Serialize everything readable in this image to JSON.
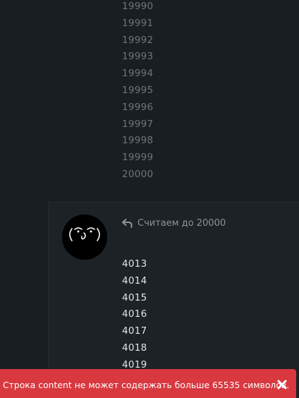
{
  "quoted_post": {
    "lines": [
      "19990",
      "19991",
      "19992",
      "19993",
      "19994",
      "19995",
      "19996",
      "19997",
      "19998",
      "19999",
      "20000"
    ]
  },
  "post": {
    "avatar_icon": "lenny-face-avatar",
    "reply_label": "Считаем до 20000",
    "lines": [
      "4013",
      "4014",
      "4015",
      "4016",
      "4017",
      "4018",
      "4019"
    ]
  },
  "error_toast": {
    "message": "Строка content не может содержать больше 65535 символов.",
    "close_icon": "close-icon"
  },
  "colors": {
    "background": "#191e22",
    "card": "#1d2226",
    "muted_text": "#6c767e",
    "post_text": "#e3e6e8",
    "toast": "#d9383f"
  }
}
